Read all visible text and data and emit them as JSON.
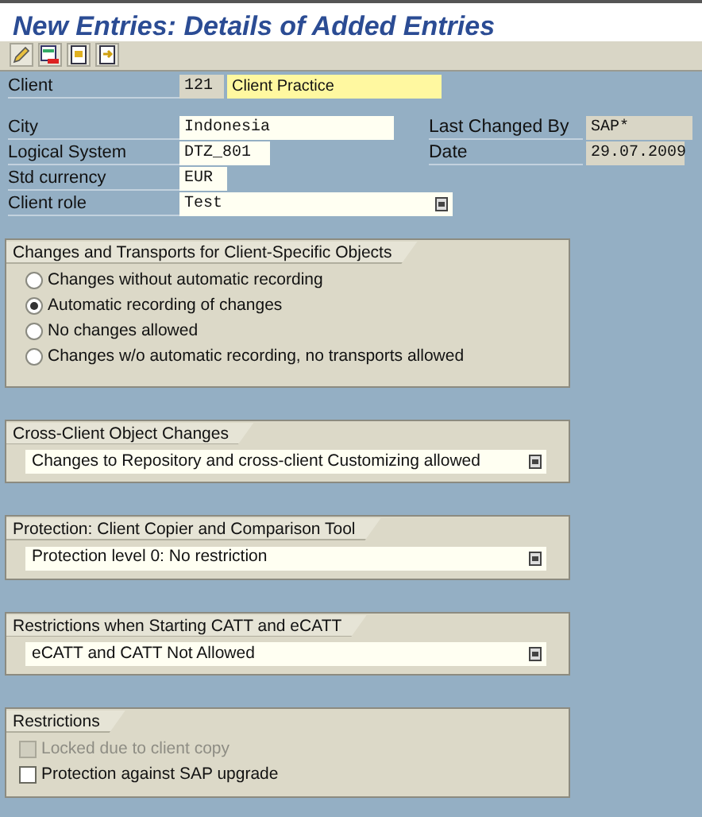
{
  "window": {
    "title": "New Entries: Details of Added Entries"
  },
  "client": {
    "label": "Client",
    "code": "121",
    "name": "Client Practice"
  },
  "fields": [
    {
      "label": "City",
      "value": "Indonesia",
      "kind": "text"
    },
    {
      "label": "Logical System",
      "value": "DTZ_801",
      "kind": "text"
    },
    {
      "label": "Std currency",
      "value": "EUR",
      "kind": "text"
    },
    {
      "label": "Client role",
      "value": "Test",
      "kind": "dropdown"
    }
  ],
  "info_fields": [
    {
      "label": "Last Changed By",
      "value": "SAP*"
    },
    {
      "label": "Date",
      "value": "29.07.2009"
    }
  ],
  "groups": [
    {
      "title": "Changes and Transports for Client-Specific Objects",
      "kind": "radio",
      "options": [
        {
          "label": "Changes without automatic recording",
          "selected": false
        },
        {
          "label": "Automatic recording of changes",
          "selected": true
        },
        {
          "label": "No changes allowed",
          "selected": false
        },
        {
          "label": "Changes w/o automatic recording, no transports allowed",
          "selected": false
        }
      ]
    },
    {
      "title": "Cross-Client Object Changes",
      "kind": "dropdown",
      "value": "Changes to Repository and cross-client Customizing allowed"
    },
    {
      "title": "Protection: Client Copier and Comparison Tool",
      "kind": "dropdown",
      "value": "Protection level 0: No restriction"
    },
    {
      "title": "Restrictions when Starting CATT and eCATT",
      "kind": "dropdown",
      "value": "eCATT and CATT Not Allowed"
    },
    {
      "title": "Restrictions",
      "kind": "checkbox",
      "options": [
        {
          "label": "Locked due to client copy",
          "checked": false,
          "disabled": true
        },
        {
          "label": "Protection against SAP upgrade",
          "checked": false,
          "disabled": false
        }
      ]
    }
  ]
}
